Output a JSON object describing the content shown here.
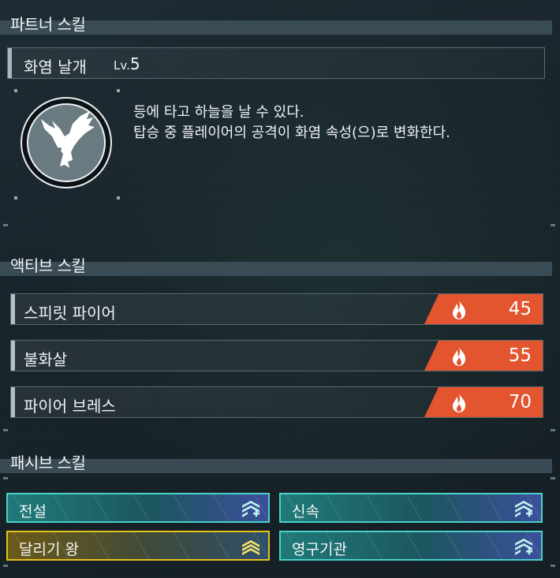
{
  "partner_skill": {
    "header": "파트너 스킬",
    "name": "화염 날개",
    "level_prefix": "Lv.",
    "level_value": "5",
    "icon": "eagle-emblem-icon",
    "description_line1": "등에 타고 하늘을 날 수 있다.",
    "description_line2": "탑승 중 플레이어의 공격이 화염 속성(으)로 변화한다."
  },
  "active_skills": {
    "header": "액티브 스킬",
    "element_icon": "fire-icon",
    "element_color": "#e2552f",
    "items": [
      {
        "name": "스피릿 파이어",
        "value": "45"
      },
      {
        "name": "불화살",
        "value": "55"
      },
      {
        "name": "파이어 브레스",
        "value": "70"
      }
    ]
  },
  "passive_skills": {
    "header": "패시브 스킬",
    "items": [
      {
        "name": "전설",
        "rank_icon": "rank-up-plus-icon",
        "color": "#4ad1c8"
      },
      {
        "name": "신속",
        "rank_icon": "rank-up-plus-icon",
        "color": "#4ad1c8"
      },
      {
        "name": "달리기 왕",
        "rank_icon": "rank-chevrons-icon",
        "color": "#e2c21a"
      },
      {
        "name": "영구기관",
        "rank_icon": "rank-up-plus-icon",
        "color": "#4ad1c8"
      }
    ]
  }
}
